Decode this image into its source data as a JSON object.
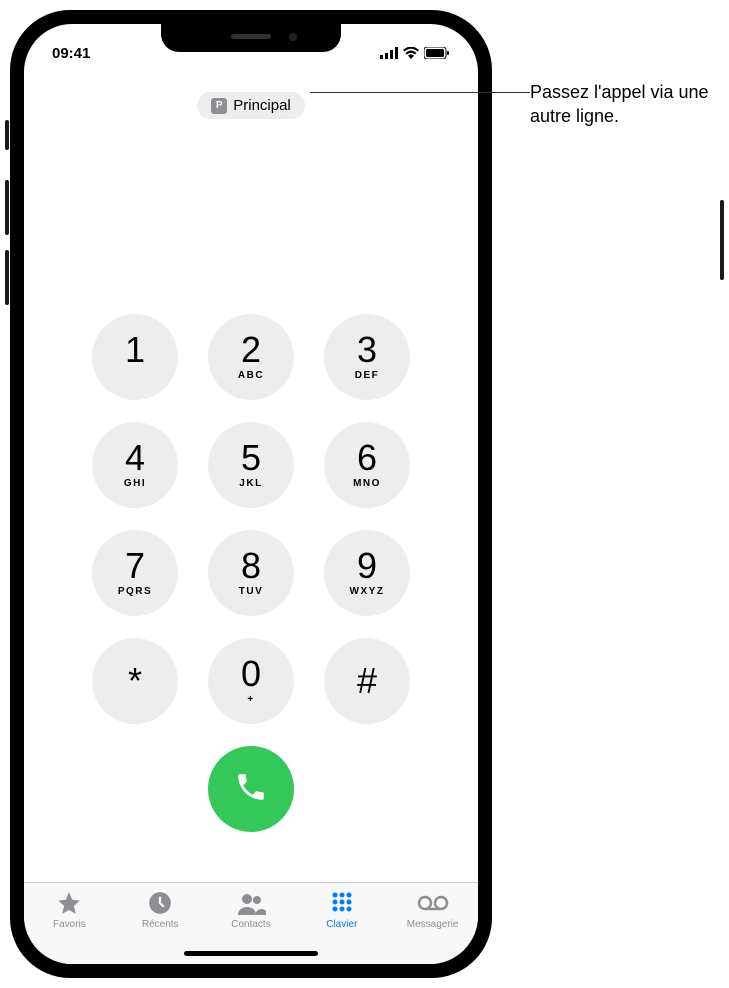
{
  "statusBar": {
    "time": "09:41"
  },
  "lineSelector": {
    "badge": "P",
    "label": "Principal"
  },
  "keypad": [
    {
      "digit": "1",
      "letters": ""
    },
    {
      "digit": "2",
      "letters": "ABC"
    },
    {
      "digit": "3",
      "letters": "DEF"
    },
    {
      "digit": "4",
      "letters": "GHI"
    },
    {
      "digit": "5",
      "letters": "JKL"
    },
    {
      "digit": "6",
      "letters": "MNO"
    },
    {
      "digit": "7",
      "letters": "PQRS"
    },
    {
      "digit": "8",
      "letters": "TUV"
    },
    {
      "digit": "9",
      "letters": "WXYZ"
    },
    {
      "digit": "*",
      "letters": ""
    },
    {
      "digit": "0",
      "letters": "+"
    },
    {
      "digit": "#",
      "letters": ""
    }
  ],
  "tabs": [
    {
      "label": "Favoris",
      "icon": "star",
      "active": false
    },
    {
      "label": "Récents",
      "icon": "clock",
      "active": false
    },
    {
      "label": "Contacts",
      "icon": "contacts",
      "active": false
    },
    {
      "label": "Clavier",
      "icon": "keypad",
      "active": true
    },
    {
      "label": "Messagerie",
      "icon": "voicemail",
      "active": false
    }
  ],
  "callout": {
    "text": "Passez l'appel via une autre ligne."
  }
}
